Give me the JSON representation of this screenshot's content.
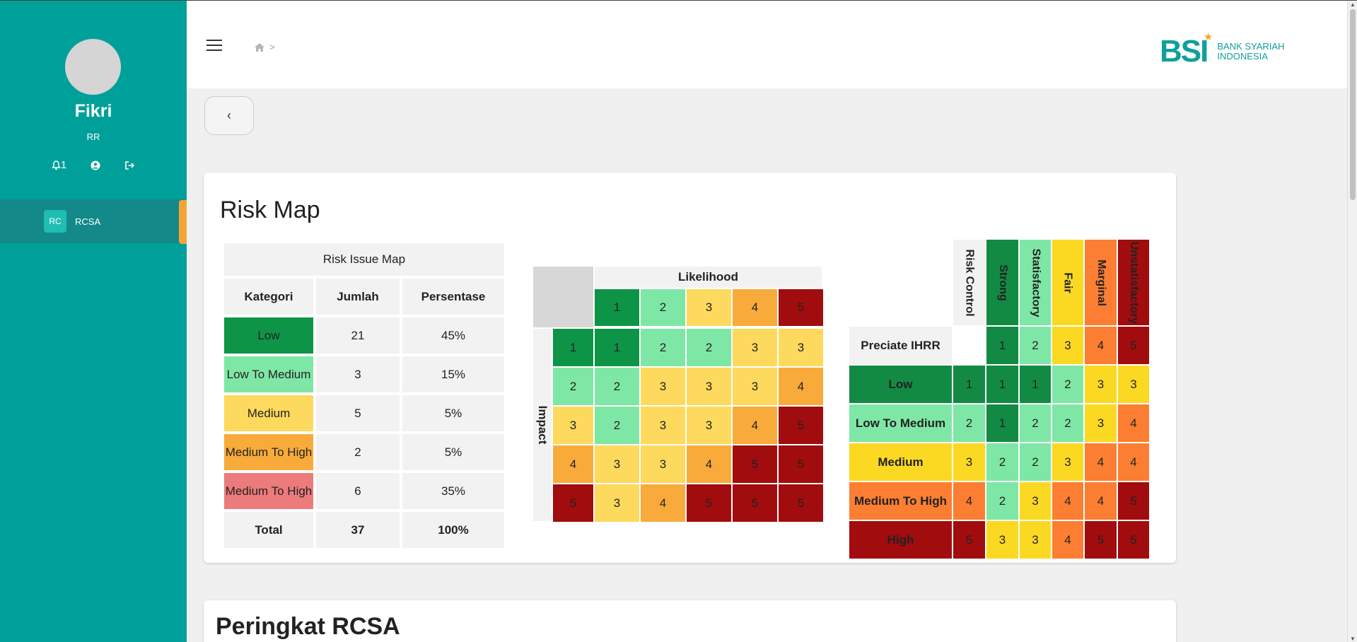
{
  "user": {
    "name": "Fikri",
    "role": "RR",
    "notification_count": "1"
  },
  "nav": {
    "badge": "RC",
    "label": "RCSA"
  },
  "breadcrumb": {
    "separator": ">"
  },
  "logo": {
    "mark": "BSI",
    "line1": "BANK SYARIAH",
    "line2": "INDONESIA"
  },
  "page": {
    "back_label": "‹",
    "title": "Risk Map",
    "next_title": "Peringkat RCSA"
  },
  "issue_table": {
    "title": "Risk Issue Map",
    "headers": [
      "Kategori",
      "Jumlah",
      "Persentase"
    ],
    "rows": [
      {
        "kategori": "Low",
        "jumlah": "21",
        "persentase": "45%",
        "color": "#0e9447"
      },
      {
        "kategori": "Low To Medium",
        "jumlah": "3",
        "persentase": "15%",
        "color": "#7fe7a6"
      },
      {
        "kategori": "Medium",
        "jumlah": "5",
        "persentase": "5%",
        "color": "#fdd95d"
      },
      {
        "kategori": "Medium To High",
        "jumlah": "2",
        "persentase": "5%",
        "color": "#f8ab3a"
      },
      {
        "kategori": "Medium To High",
        "jumlah": "6",
        "persentase": "35%",
        "color": "#ec7b7b"
      }
    ],
    "total": {
      "label": "Total",
      "jumlah": "37",
      "persentase": "100%"
    }
  },
  "heatmap": {
    "likelihood_label": "Likelihood",
    "impact_label": "Impact",
    "columns": [
      "1",
      "2",
      "3",
      "4",
      "5"
    ],
    "rows": [
      {
        "impact": "1",
        "values": [
          "1",
          "2",
          "2",
          "3",
          "3"
        ]
      },
      {
        "impact": "2",
        "values": [
          "2",
          "3",
          "3",
          "3",
          "4"
        ]
      },
      {
        "impact": "3",
        "values": [
          "2",
          "3",
          "3",
          "4",
          "5"
        ]
      },
      {
        "impact": "4",
        "values": [
          "3",
          "3",
          "4",
          "5",
          "5"
        ]
      },
      {
        "impact": "5",
        "values": [
          "3",
          "4",
          "5",
          "5",
          "5"
        ]
      }
    ]
  },
  "control_matrix": {
    "columns": [
      "Risk Control",
      "Strong",
      "Statisfactory",
      "Fair",
      "Marginal",
      "Unstatisfactory"
    ],
    "corner_label": "Preciate IHRR",
    "header_values": [
      "1",
      "2",
      "3",
      "4",
      "5"
    ],
    "rows": [
      {
        "label": "Low",
        "level": "1",
        "values": [
          "1",
          "1",
          "2",
          "3",
          "3"
        ]
      },
      {
        "label": "Low To Medium",
        "level": "2",
        "values": [
          "1",
          "2",
          "2",
          "3",
          "4"
        ]
      },
      {
        "label": "Medium",
        "level": "3",
        "values": [
          "2",
          "2",
          "3",
          "4",
          "4"
        ]
      },
      {
        "label": "Medium To High",
        "level": "4",
        "values": [
          "2",
          "3",
          "4",
          "4",
          "5"
        ]
      },
      {
        "label": "High",
        "level": "5",
        "values": [
          "3",
          "3",
          "4",
          "5",
          "5"
        ]
      }
    ]
  },
  "colors": {
    "sidebar": "#00a09a",
    "level_1_dark": "#0e9447",
    "level_1": "#128a44",
    "level_2": "#7fe7a6",
    "level_3": "#fdd95d",
    "level_3_bright": "#fbd923",
    "level_4": "#f8ab3a",
    "level_4_orange": "#fb7e32",
    "level_5": "#a10c0e",
    "accent": "#f5a437"
  }
}
